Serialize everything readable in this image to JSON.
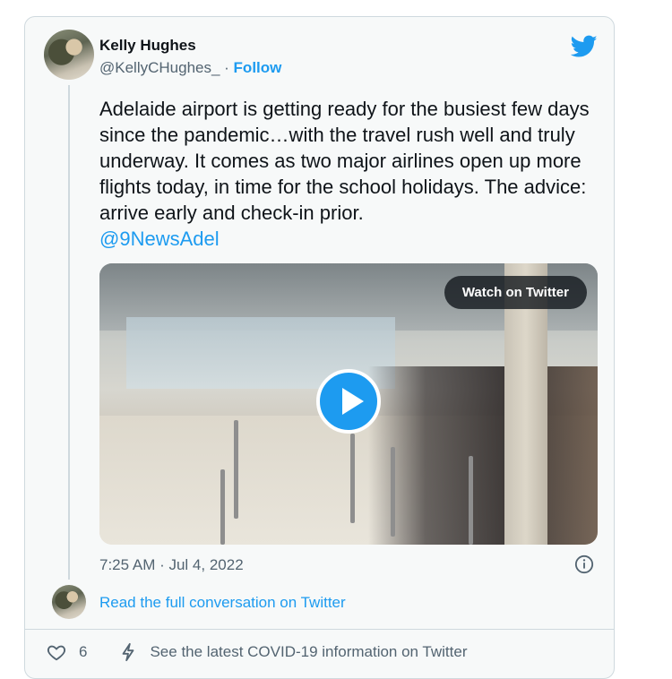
{
  "tweet": {
    "author_name": "Kelly Hughes",
    "handle": "@KellyCHughes_",
    "separator": " · ",
    "follow_label": "Follow",
    "text": "Adelaide airport is getting ready for the busiest few days since the pandemic…with the travel rush well and truly underway. It comes as two major airlines open up more flights today, in time for the school holidays. The advice: arrive early and check-in prior.",
    "mention": "@9NewsAdel",
    "timestamp": "7:25 AM · Jul 4, 2022",
    "read_full_label": "Read the full conversation on Twitter"
  },
  "media": {
    "watch_label": "Watch on Twitter",
    "play_icon": "play-icon"
  },
  "footer": {
    "like_count": "6",
    "covid_label": "See the latest COVID-19 information on Twitter"
  },
  "icons": {
    "brand": "twitter-bird-icon",
    "info": "info-icon",
    "like": "heart-icon",
    "covid": "lightning-icon"
  },
  "colors": {
    "accent": "#1d9bf0",
    "card_bg": "#f7f9f9",
    "border": "#cfd9de",
    "secondary_text": "#536471"
  }
}
